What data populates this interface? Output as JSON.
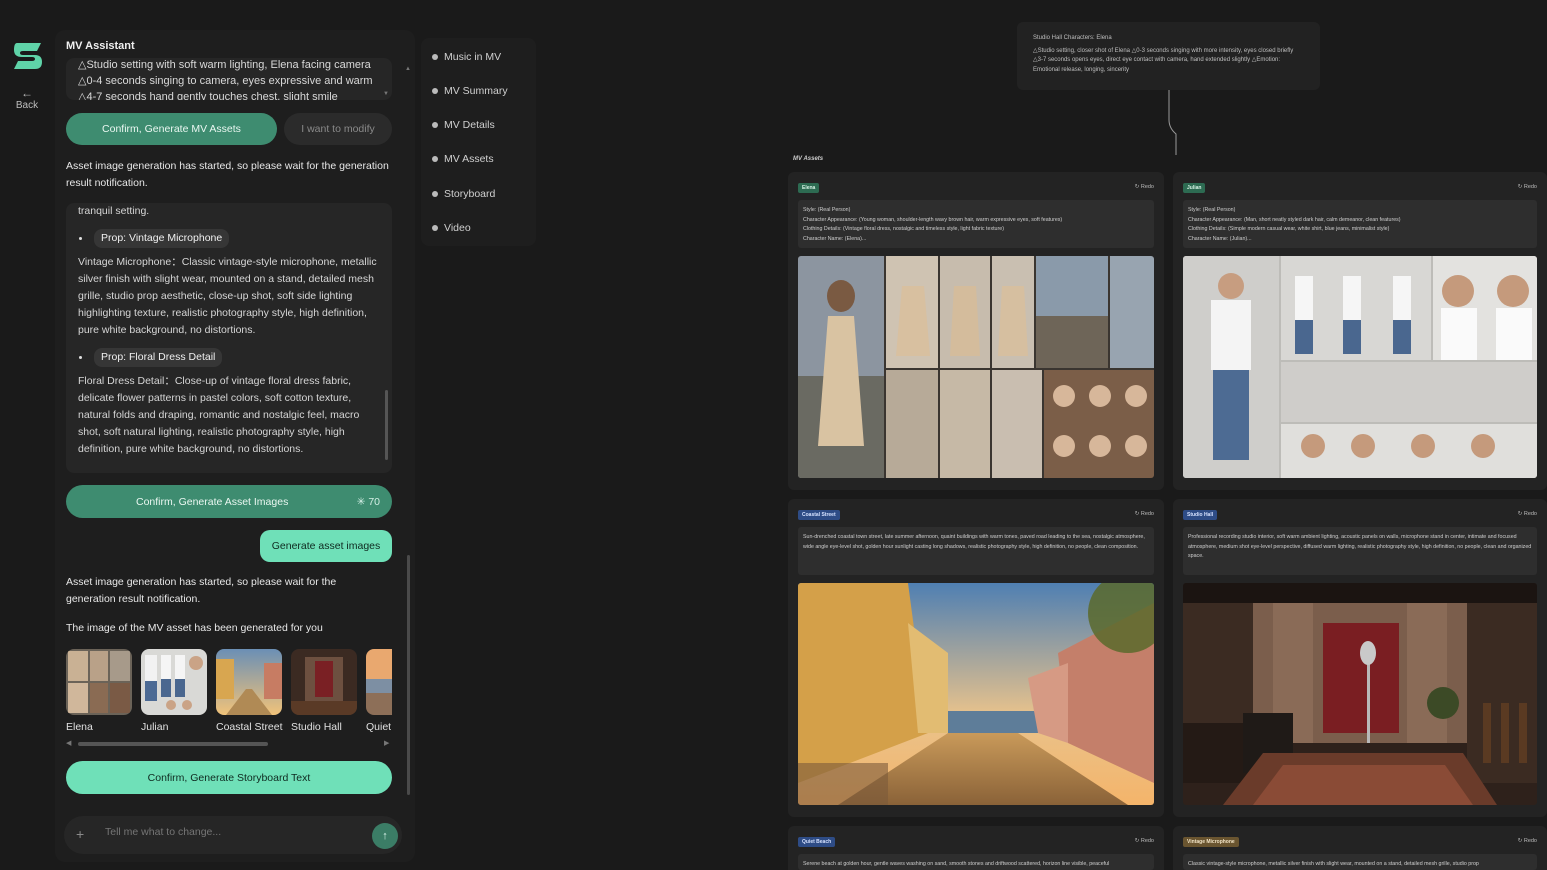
{
  "rail": {
    "back_label": "Back",
    "back_arrow": "←"
  },
  "panel": {
    "title": "MV Assistant",
    "scene_lines": [
      "△Studio setting with soft warm lighting, Elena facing camera",
      "△0-4 seconds singing to camera, eyes expressive and warm",
      "△4-7 seconds hand gently touches chest, slight smile"
    ],
    "confirm_assets_label": "Confirm, Generate MV Assets",
    "modify_label": "I want to modify",
    "started_message": "Asset image generation has started, so please wait for the generation result notification.",
    "box_intro": "tranquil setting.",
    "props": [
      {
        "tag": "Prop: Vintage Microphone",
        "desc": "Vintage Microphone：Classic vintage-style microphone, metallic silver finish with slight wear, mounted on a stand, detailed mesh grille, studio prop aesthetic, close-up shot, soft side lighting highlighting texture, realistic photography style, high definition, pure white background, no distortions."
      },
      {
        "tag": "Prop: Floral Dress Detail",
        "desc": "Floral Dress Detail：Close-up of vintage floral dress fabric, delicate flower patterns in pastel colors, soft cotton texture, natural folds and draping, romantic and nostalgic feel, macro shot, soft natural lighting, realistic photography style, high definition, pure white background, no distortions."
      }
    ],
    "confirm_images_label": "Confirm, Generate Asset Images",
    "confirm_images_cost": "70",
    "user_bubble": "Generate asset images",
    "started_message_2": "Asset image generation has started, so please wait for the generation result notification.",
    "generated_message": "The image of the MV asset has been generated for you",
    "thumbnails": [
      "Elena",
      "Julian",
      "Coastal Street",
      "Studio Hall",
      "Quiet"
    ],
    "storyboard_label": "Confirm, Generate Storyboard Text",
    "input_placeholder": "Tell me what to change...",
    "plus_icon": "+",
    "send_icon": "↑"
  },
  "nav": {
    "items": [
      "Music in MV",
      "MV Summary",
      "MV Details",
      "MV Assets",
      "Storyboard",
      "Video"
    ]
  },
  "canvas": {
    "top_card": {
      "header": "Studio Hall Characters: Elena",
      "body": "△Studio setting, closer shot of Elena △0-3 seconds singing with more intensity, eyes closed briefly △3-7 seconds opens eyes, direct eye contact with camera, hand extended slightly △Emotion: Emotional release, longing, sincerity"
    },
    "group_label": "MV Assets",
    "redo_label": "Redo",
    "cards": [
      {
        "tag": "Elena",
        "lines": [
          "Style: (Real Person)",
          "Character Appearance: (Young woman, shoulder-length wavy brown hair, warm expressive eyes, soft features)",
          "Clothing Details: (Vintage floral dress, nostalgic and timeless style, light fabric texture)",
          "Character Name: (Elena)..."
        ]
      },
      {
        "tag": "Julian",
        "lines": [
          "Style: (Real Person)",
          "Character Appearance: (Man, short neatly styled dark hair, calm demeanor, clean features)",
          "Clothing Details: (Simple modern casual wear, white shirt, blue jeans, minimalist style)",
          "Character Name: (Julian)..."
        ]
      },
      {
        "tag": "Coastal Street",
        "lines": [
          "Sun-drenched coastal town street, late summer afternoon, quaint buildings with warm tones, paved road leading to the sea, nostalgic atmosphere, wide angle eye-level shot, golden hour sunlight casting long shadows, realistic photography style, high definition, no people, clean composition."
        ]
      },
      {
        "tag": "Studio Hall",
        "lines": [
          "Professional recording studio interior, soft warm ambient lighting, acoustic panels on walls, microphone stand in center, intimate and focused atmosphere, medium shot eye-level perspective, diffused warm lighting, realistic photography style, high definition, no people, clean and organized space."
        ]
      },
      {
        "tag": "Quiet Beach",
        "lines": [
          "Serene beach at golden hour, gentle waves washing on sand, smooth stones and driftwood scattered, horizon line visible, peaceful"
        ]
      },
      {
        "tag": "Vintage Microphone",
        "lines": [
          "Classic vintage-style microphone, metallic silver finish with slight wear, mounted on a stand, detailed mesh grille, studio prop"
        ]
      }
    ]
  },
  "colors": {
    "accent_green": "#3e8c70",
    "accent_mint": "#6fe0b8",
    "background": "#1a1a1a"
  }
}
